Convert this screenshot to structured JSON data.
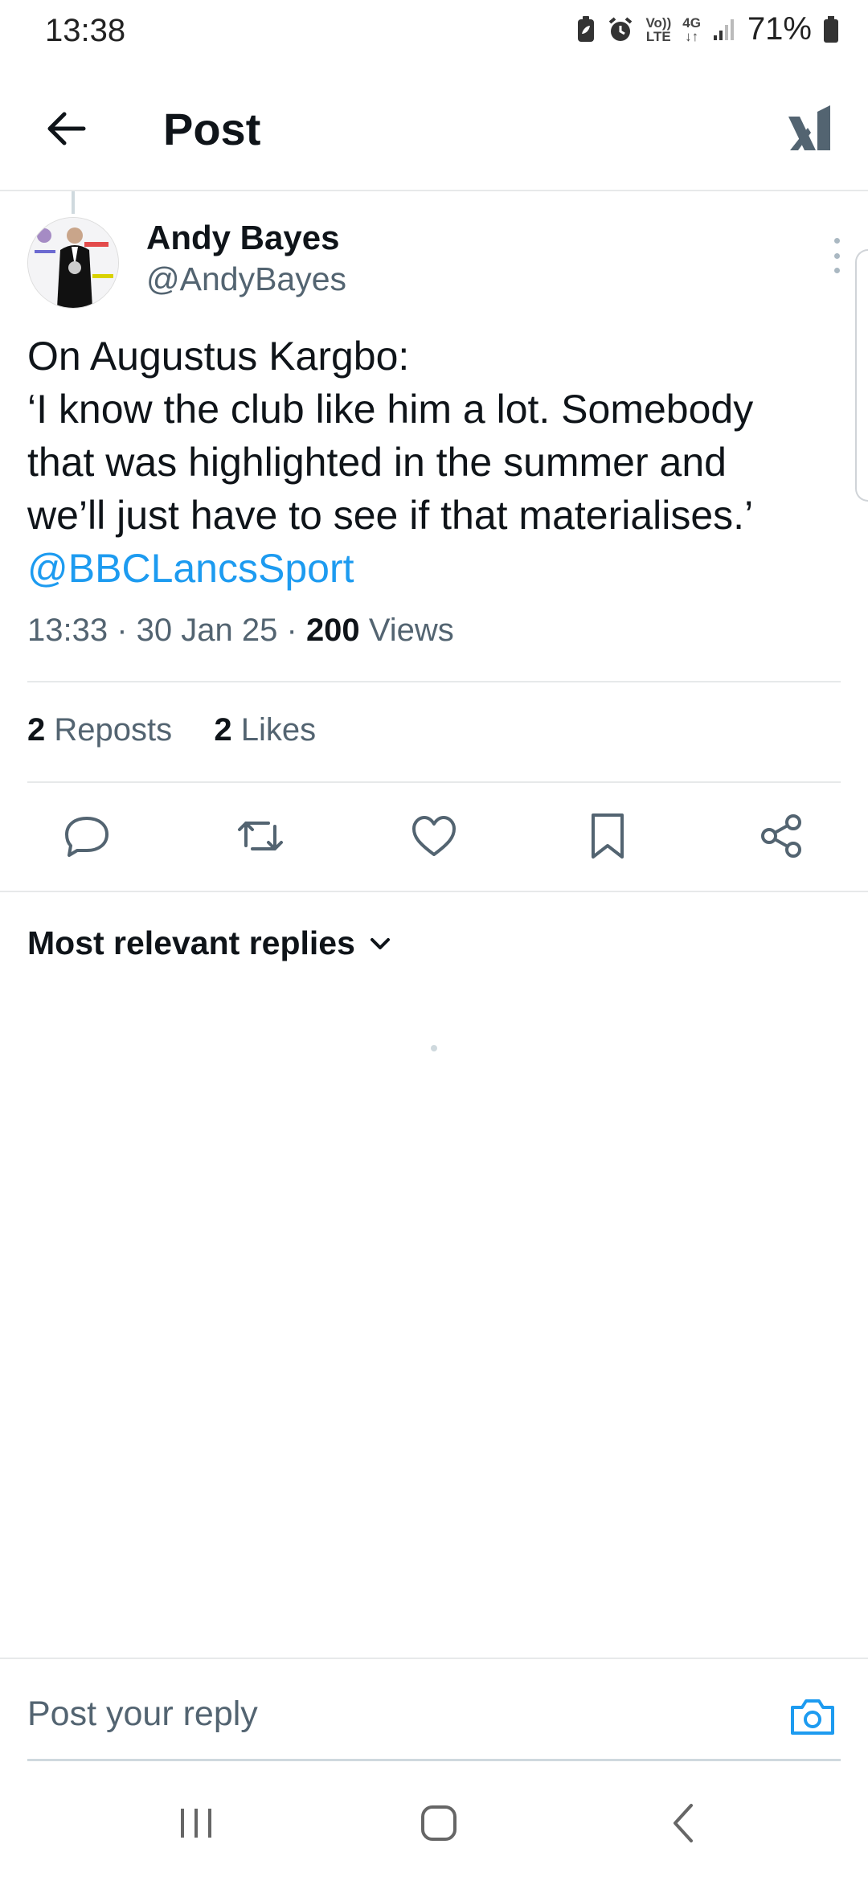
{
  "status_bar": {
    "time": "13:38",
    "network_top": "Vo))",
    "network_bottom": "LTE",
    "data_label": "4G",
    "battery": "71%"
  },
  "header": {
    "title": "Post",
    "back_icon": "arrow-left-icon",
    "brand_icon": "x-logo-icon"
  },
  "post": {
    "author_name": "Andy Bayes",
    "author_handle": "@AndyBayes",
    "lines": [
      "On Augustus Kargbo:",
      "‘I know the club like him a lot. Somebody",
      "that was highlighted in the summer and",
      "we’ll just have to see if that materialises.’"
    ],
    "mention": "@BBCLancsSport",
    "time": "13:33",
    "date": "30 Jan 25",
    "views_count": "200",
    "views_label": "Views",
    "reposts_count": "2",
    "reposts_label": "Reposts",
    "likes_count": "2",
    "likes_label": "Likes"
  },
  "actions": {
    "icons": [
      "reply-icon",
      "repost-icon",
      "like-icon",
      "bookmark-icon",
      "share-icon"
    ]
  },
  "replies": {
    "sort_label": "Most relevant replies"
  },
  "reply_bar": {
    "placeholder": "Post your reply"
  },
  "colors": {
    "accent": "#1d9bf0",
    "text_primary": "#0f1419",
    "text_secondary": "#536471",
    "divider": "#e7e9ea"
  }
}
